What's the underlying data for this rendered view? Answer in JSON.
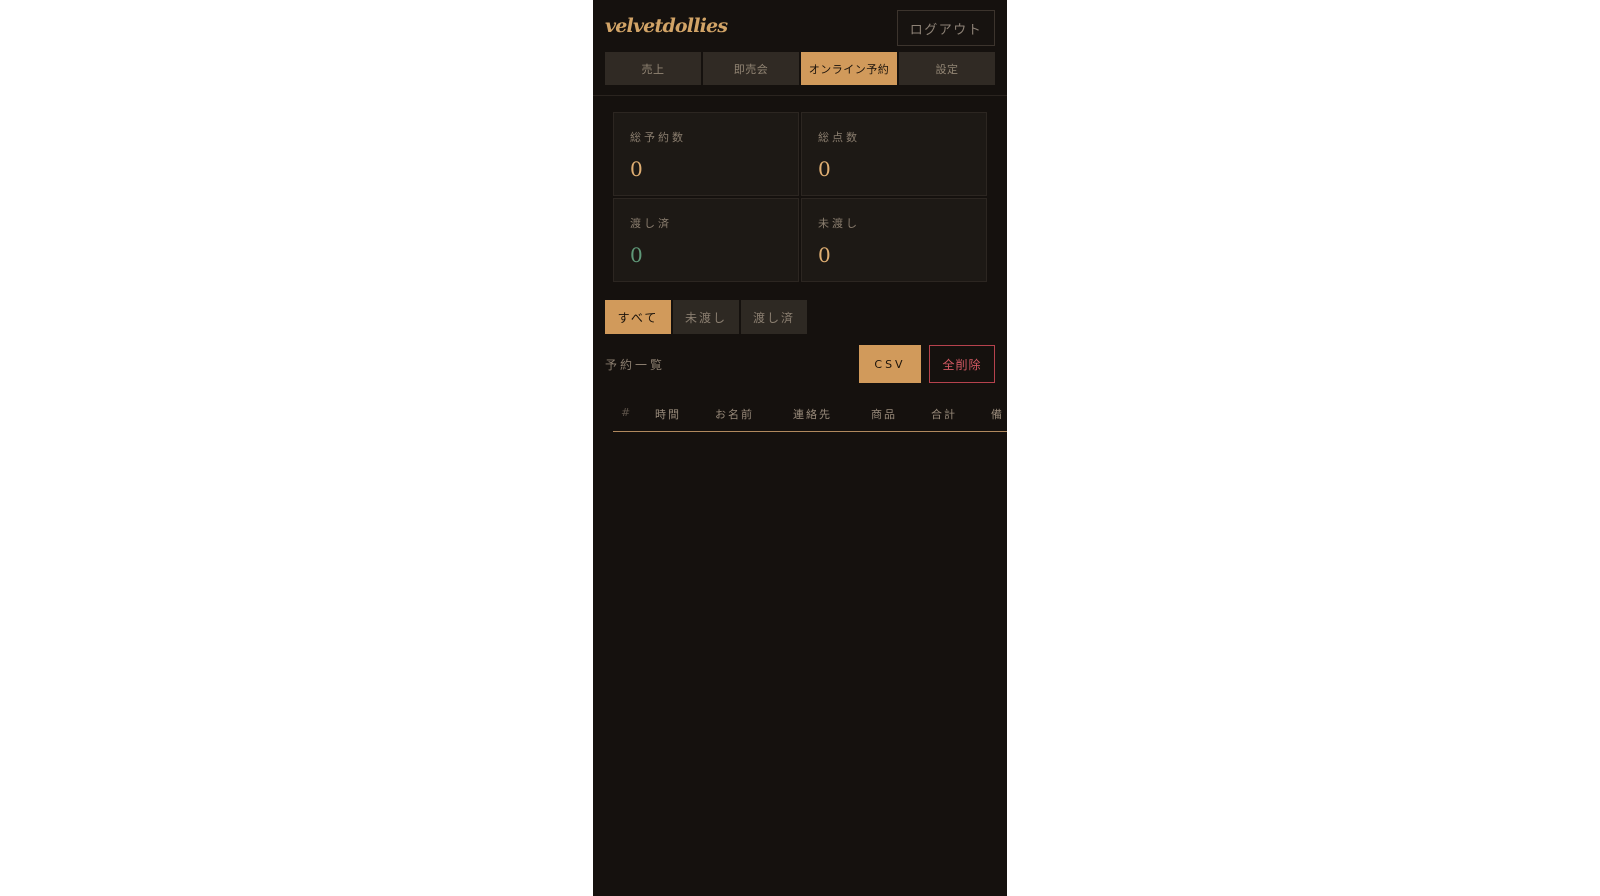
{
  "header": {
    "brand": "velvetdollies",
    "logout_label": "ログアウト"
  },
  "tabs": [
    {
      "label": "売上",
      "active": false
    },
    {
      "label": "即売会",
      "active": false
    },
    {
      "label": "オンライン予約",
      "active": true
    },
    {
      "label": "設定",
      "active": false
    }
  ],
  "stats": [
    {
      "label": "総予約数",
      "value": "0",
      "color": "#dfae72"
    },
    {
      "label": "総点数",
      "value": "0",
      "color": "#dfae72"
    },
    {
      "label": "渡し済",
      "value": "0",
      "color": "#5f9878"
    },
    {
      "label": "未渡し",
      "value": "0",
      "color": "#dfae72"
    }
  ],
  "filters": [
    {
      "label": "すべて",
      "active": true
    },
    {
      "label": "未渡し",
      "active": false
    },
    {
      "label": "渡し済",
      "active": false
    }
  ],
  "list": {
    "title": "予約一覧",
    "csv_label": "CSV",
    "delete_all_label": "全削除"
  },
  "table": {
    "columns": [
      "#",
      "時間",
      "お名前",
      "連絡先",
      "商品",
      "合計",
      "備"
    ]
  },
  "colors": {
    "background": "#15110e",
    "accent": "#d19a5b",
    "danger": "#d35963",
    "green": "#5f9878"
  }
}
